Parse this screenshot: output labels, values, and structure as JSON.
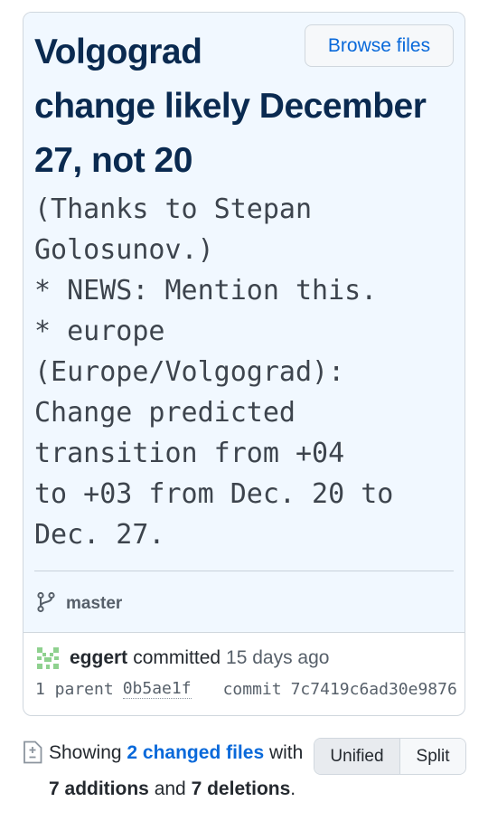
{
  "commit": {
    "title_line1": "Volgograd",
    "title_rest": "change likely December 27, not 20",
    "description": "(Thanks to Stepan\nGolosunov.)\n* NEWS: Mention this.\n* europe\n(Europe/Volgograd):\nChange predicted\ntransition from +04\nto +03 from Dec. 20 to\nDec. 27.",
    "browse_files_label": "Browse files",
    "branch": "master",
    "author": "eggert",
    "committed_word": "committed",
    "when": "15 days ago",
    "parent_label": "1 parent",
    "parent_sha": "0b5ae1f",
    "commit_label": "commit",
    "commit_sha": "7c7419c6ad30e9876"
  },
  "summary": {
    "showing": "Showing",
    "changed_files": "2 changed files",
    "with": "with",
    "additions": "7 additions",
    "and": "and",
    "deletions": "7 deletions",
    "period": "."
  },
  "view_toggle": {
    "unified": "Unified",
    "split": "Split",
    "selected": "Unified"
  },
  "icons": {
    "branch": "git-branch-icon",
    "avatar": "identicon-avatar",
    "file_diff": "file-diff-icon"
  },
  "colors": {
    "link": "#0969da",
    "title": "#0a2a50",
    "header_bg": "#f1f8ff",
    "avatar": "#8fd18f"
  }
}
